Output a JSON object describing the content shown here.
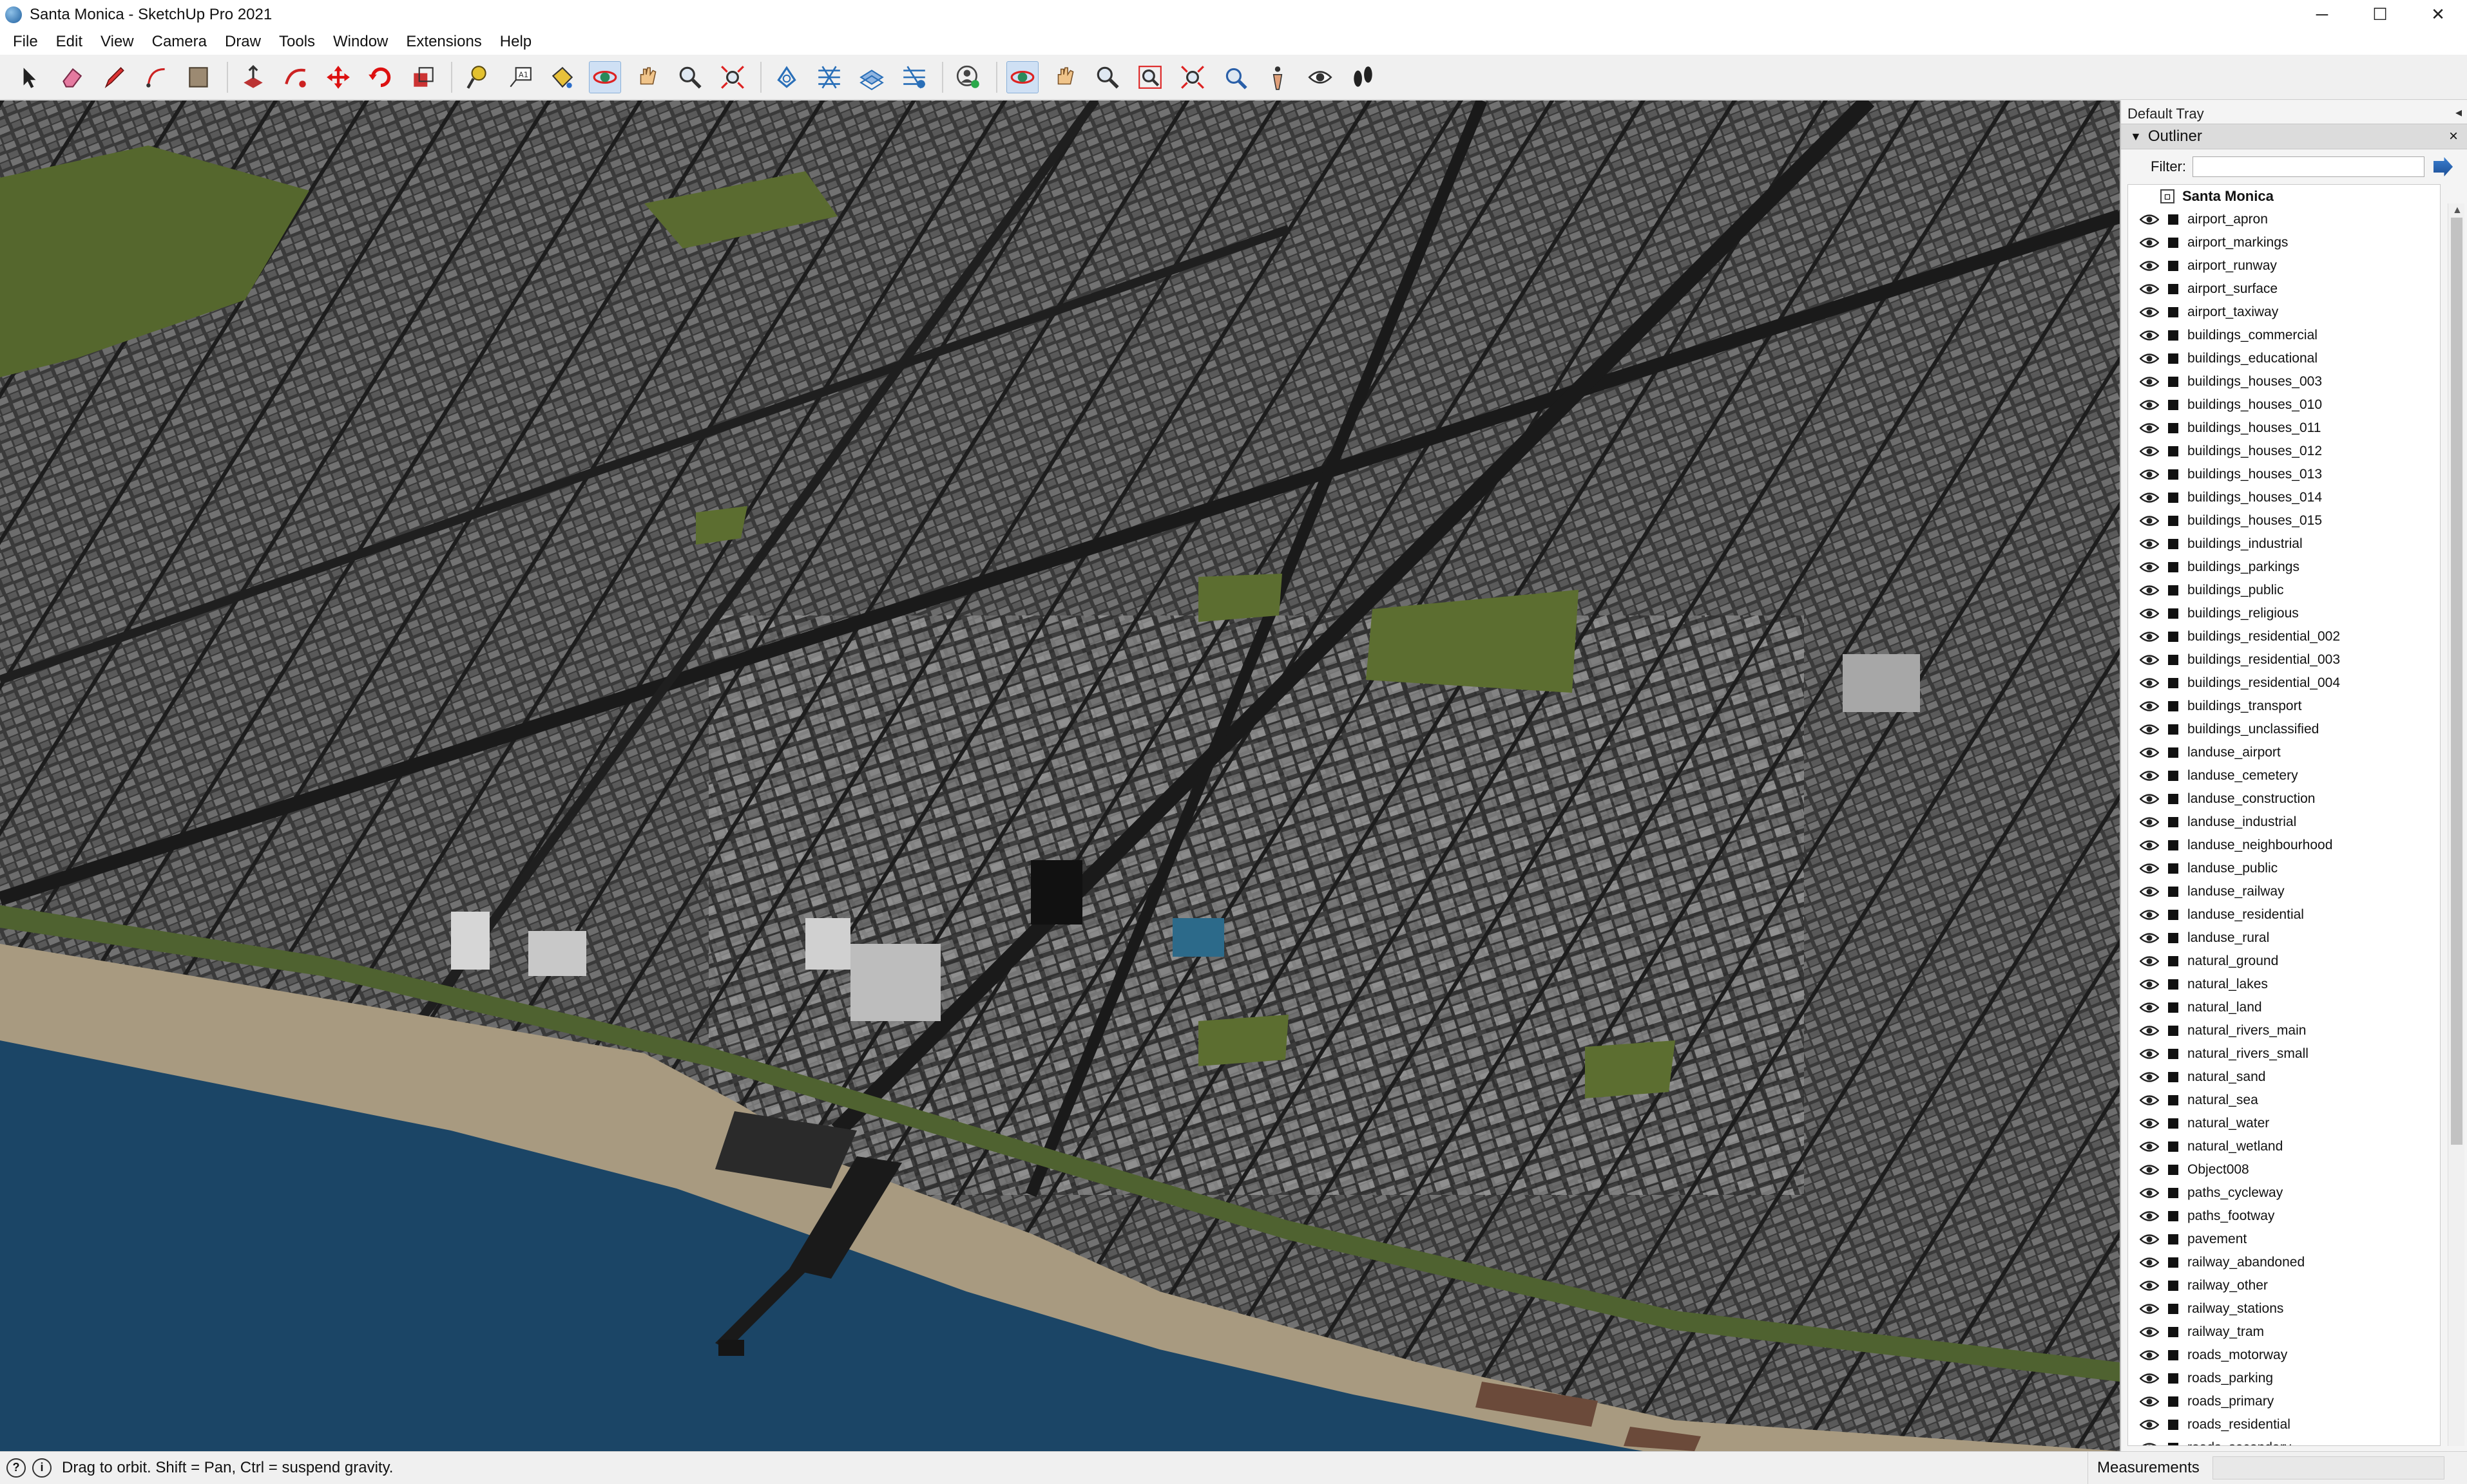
{
  "window": {
    "title": "Santa Monica - SketchUp Pro 2021",
    "controls": {
      "minimize": "─",
      "maximize": "☐",
      "close": "✕"
    }
  },
  "menu": [
    "File",
    "Edit",
    "View",
    "Camera",
    "Draw",
    "Tools",
    "Window",
    "Extensions",
    "Help"
  ],
  "toolbar": {
    "icons": [
      "select-icon",
      "eraser-icon",
      "line-pencil-icon",
      "arc-icon",
      "rectangle-shape-icon",
      "push-pull-icon",
      "follow-me-icon",
      "move-icon",
      "rotate-icon",
      "scale-icon",
      "tape-measure-icon",
      "text-label-icon",
      "paint-bucket-icon",
      "orbit-icon",
      "pan-icon",
      "zoom-icon",
      "zoom-extents-icon",
      "sandbox-from-contours-icon",
      "sandbox-smoove-icon",
      "sandbox-stamp-icon",
      "sandbox-flip-icon",
      "user-account-icon",
      "orbit-icon-2",
      "pan-icon-2",
      "zoom-icon-2",
      "zoom-window-icon",
      "zoom-extents-icon-2",
      "previous-view-icon",
      "position-camera-icon",
      "look-around-icon",
      "walk-icon"
    ],
    "active": [
      "orbit-icon",
      "orbit-icon-2"
    ]
  },
  "viewport": {
    "description_colors": {
      "sea": "#1b4566",
      "sand": "#a89a80",
      "city": "#3b3b3b",
      "park": "#55672d"
    }
  },
  "tray": {
    "title": "Default Tray",
    "pin": "◂",
    "panel": {
      "title": "Outliner",
      "close": "×",
      "filter_label": "Filter:",
      "filter_value": "",
      "root": "Santa Monica",
      "items": [
        "airport_apron",
        "airport_markings",
        "airport_runway",
        "airport_surface",
        "airport_taxiway",
        "buildings_commercial",
        "buildings_educational",
        "buildings_houses_003",
        "buildings_houses_010",
        "buildings_houses_011",
        "buildings_houses_012",
        "buildings_houses_013",
        "buildings_houses_014",
        "buildings_houses_015",
        "buildings_industrial",
        "buildings_parkings",
        "buildings_public",
        "buildings_religious",
        "buildings_residential_002",
        "buildings_residential_003",
        "buildings_residential_004",
        "buildings_transport",
        "buildings_unclassified",
        "landuse_airport",
        "landuse_cemetery",
        "landuse_construction",
        "landuse_industrial",
        "landuse_neighbourhood",
        "landuse_public",
        "landuse_railway",
        "landuse_residential",
        "landuse_rural",
        "natural_ground",
        "natural_lakes",
        "natural_land",
        "natural_rivers_main",
        "natural_rivers_small",
        "natural_sand",
        "natural_sea",
        "natural_water",
        "natural_wetland",
        "Object008",
        "paths_cycleway",
        "paths_footway",
        "pavement",
        "railway_abandoned",
        "railway_other",
        "railway_stations",
        "railway_tram",
        "roads_motorway",
        "roads_parking",
        "roads_primary",
        "roads_residential",
        "roads_secondary"
      ]
    }
  },
  "status": {
    "icon1": "?",
    "icon2": "i",
    "message": "Drag to orbit. Shift = Pan, Ctrl = suspend gravity.",
    "measurements_label": "Measurements",
    "measurements_value": ""
  }
}
